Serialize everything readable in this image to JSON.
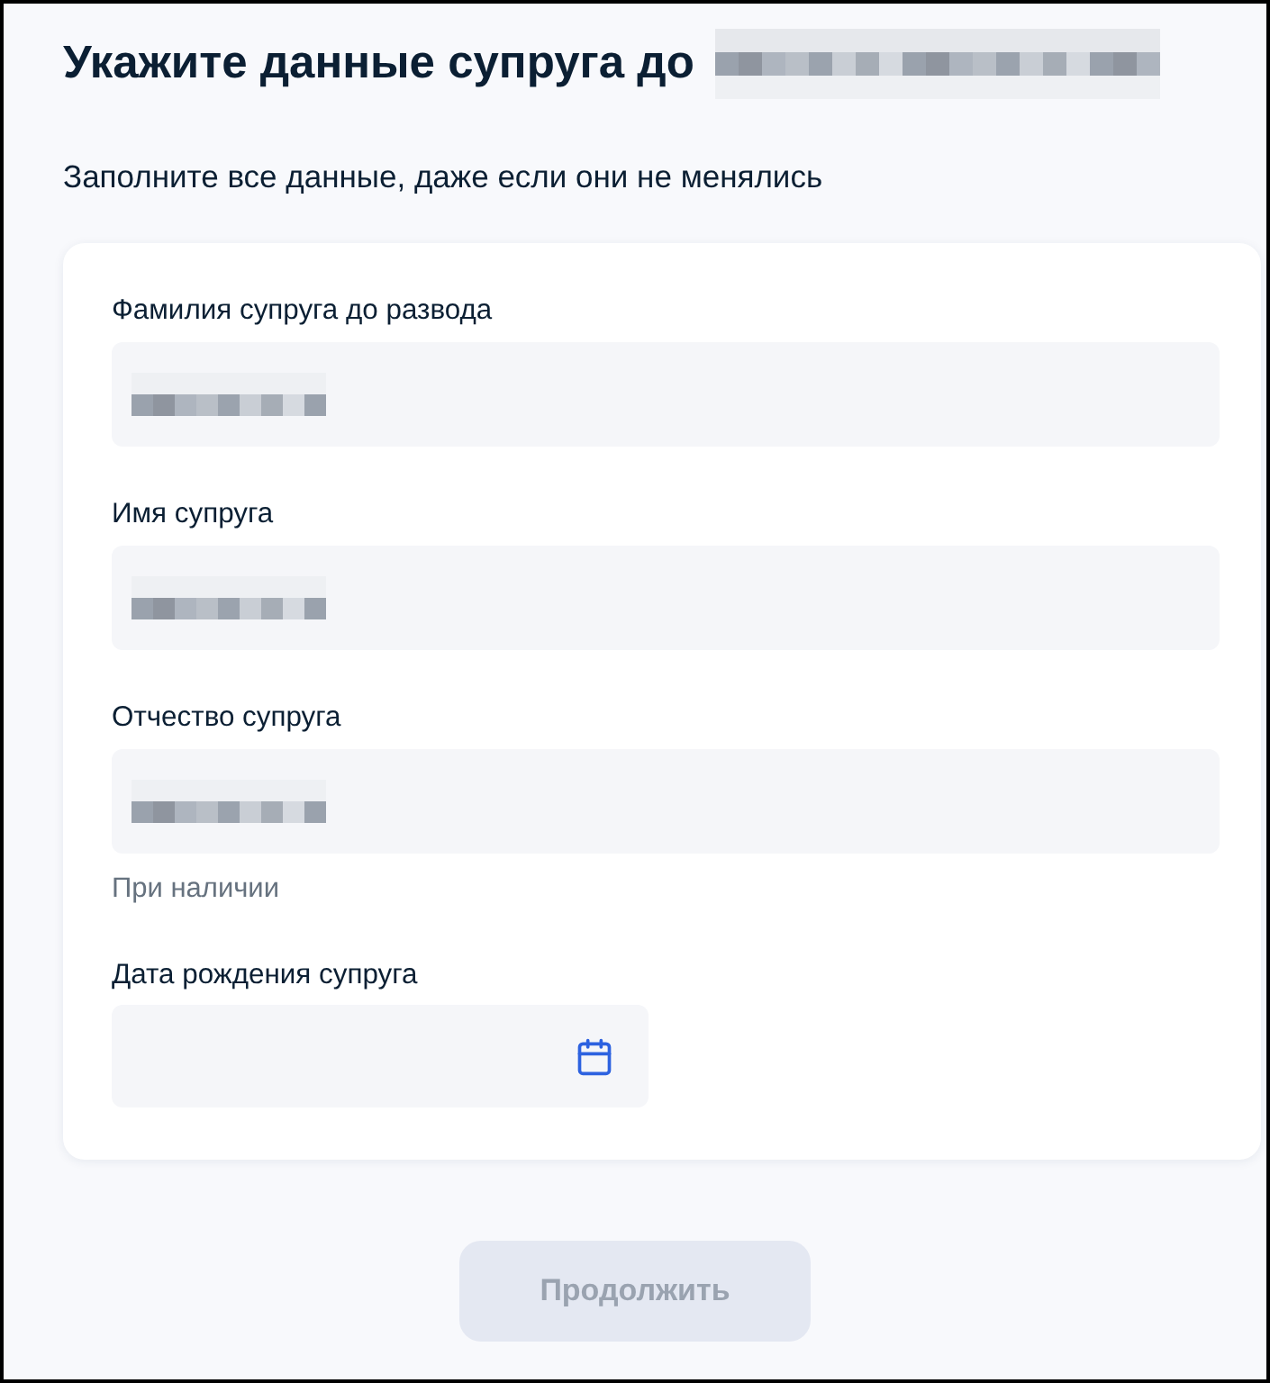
{
  "header": {
    "title": "Укажите данные супруга до",
    "title_redacted": true,
    "subtitle": "Заполните все данные, даже если они не менялись"
  },
  "form": {
    "fields": [
      {
        "kind": "text",
        "label": "Фамилия супруга до развода",
        "value_redacted": true
      },
      {
        "kind": "text",
        "label": "Имя супруга",
        "value_redacted": true
      },
      {
        "kind": "text",
        "label": "Отчество супруга",
        "value_redacted": true,
        "hint": "При наличии"
      },
      {
        "kind": "date",
        "label": "Дата рождения супруга"
      }
    ]
  },
  "continue_button": {
    "label": "Продолжить",
    "disabled": true
  }
}
